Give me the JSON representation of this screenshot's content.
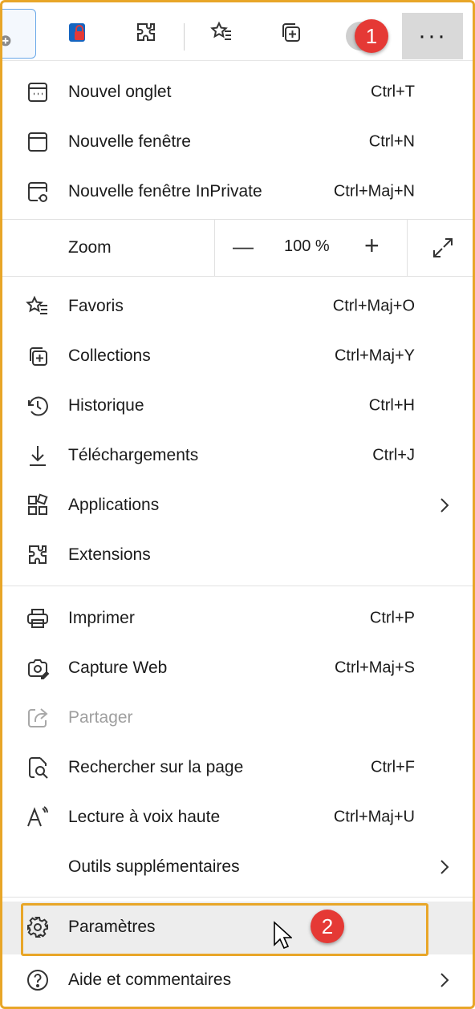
{
  "toolbar": {
    "more_label": "···",
    "buttons": [
      "tab-actions-icon",
      "password-lock-icon",
      "extensions-icon",
      "favorites-icon",
      "collections-icon",
      "profile-avatar",
      "more-options-icon"
    ]
  },
  "badges": {
    "one": "1",
    "two": "2"
  },
  "menu": {
    "new_tab": {
      "label": "Nouvel onglet",
      "shortcut": "Ctrl+T"
    },
    "new_window": {
      "label": "Nouvelle fenêtre",
      "shortcut": "Ctrl+N"
    },
    "inprivate": {
      "label": "Nouvelle fenêtre InPrivate",
      "shortcut": "Ctrl+Maj+N"
    },
    "zoom": {
      "label": "Zoom",
      "minus": "—",
      "value": "100 %",
      "plus": "+"
    },
    "favorites": {
      "label": "Favoris",
      "shortcut": "Ctrl+Maj+O"
    },
    "collections": {
      "label": "Collections",
      "shortcut": "Ctrl+Maj+Y"
    },
    "history": {
      "label": "Historique",
      "shortcut": "Ctrl+H"
    },
    "downloads": {
      "label": "Téléchargements",
      "shortcut": "Ctrl+J"
    },
    "apps": {
      "label": "Applications"
    },
    "extensions": {
      "label": "Extensions"
    },
    "print": {
      "label": "Imprimer",
      "shortcut": "Ctrl+P"
    },
    "capture": {
      "label": "Capture Web",
      "shortcut": "Ctrl+Maj+S"
    },
    "share": {
      "label": "Partager"
    },
    "find": {
      "label": "Rechercher sur la page",
      "shortcut": "Ctrl+F"
    },
    "read_aloud": {
      "label": "Lecture à voix haute",
      "shortcut": "Ctrl+Maj+U"
    },
    "more_tools": {
      "label": "Outils supplémentaires"
    },
    "settings": {
      "label": "Paramètres"
    },
    "help": {
      "label": "Aide et commentaires"
    }
  },
  "colors": {
    "highlight": "#e8a628",
    "badge": "#e53935",
    "hover": "#ededed"
  }
}
